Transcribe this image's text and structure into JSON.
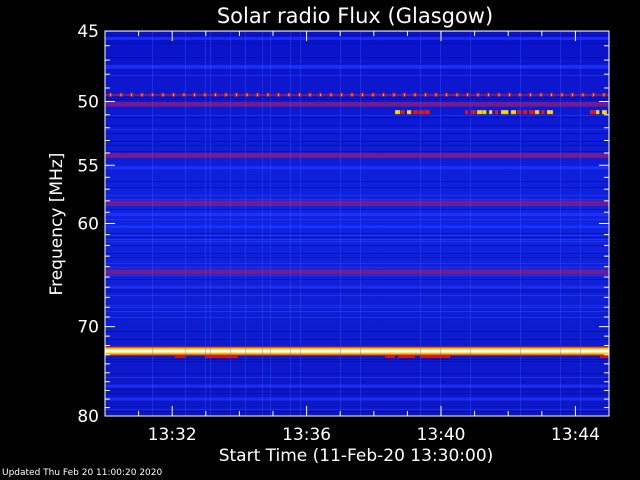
{
  "chart_data": {
    "type": "heatmap",
    "title": "Solar radio Flux (Glasgow)",
    "xlabel": "Start Time (11-Feb-20 13:30:00)",
    "ylabel": "Frequency [MHz]",
    "start_time": "13:30:00",
    "xlim": [
      "13:30:00",
      "13:45:00"
    ],
    "ylim": [
      45,
      80
    ],
    "y_inverted": true,
    "y_scale": "log",
    "x_tick_labels": [
      "13:32",
      "13:36",
      "13:40",
      "13:44"
    ],
    "x_tick_values": [
      "13:32:00",
      "13:36:00",
      "13:40:00",
      "13:44:00"
    ],
    "y_tick_labels": [
      "45",
      "50",
      "55",
      "60",
      "70",
      "80"
    ],
    "y_tick_values": [
      45,
      50,
      55,
      60,
      70,
      80
    ],
    "colormap": [
      "#0000b0",
      "#2233ff",
      "#7a1d8c",
      "#d81a1a",
      "#ffd000",
      "#ffffff"
    ],
    "emission_bands_mhz": [
      {
        "freq": 45.5,
        "level": "low"
      },
      {
        "freq": 47.5,
        "level": "low"
      },
      {
        "freq": 49.5,
        "level": "pulsed"
      },
      {
        "freq": 50.2,
        "level": "medium"
      },
      {
        "freq": 50.8,
        "level": "intermittent"
      },
      {
        "freq": 54.2,
        "level": "medium"
      },
      {
        "freq": 55.2,
        "level": "low"
      },
      {
        "freq": 58.2,
        "level": "medium"
      },
      {
        "freq": 59.2,
        "level": "low"
      },
      {
        "freq": 60.3,
        "level": "low"
      },
      {
        "freq": 64.5,
        "level": "medium"
      },
      {
        "freq": 66.0,
        "level": "low"
      },
      {
        "freq": 72.6,
        "level": "saturated"
      },
      {
        "freq": 76.5,
        "level": "low"
      },
      {
        "freq": 78.0,
        "level": "low"
      }
    ]
  },
  "footer": {
    "updated": "Updated Thu Feb 20 11:00:20 2020"
  }
}
